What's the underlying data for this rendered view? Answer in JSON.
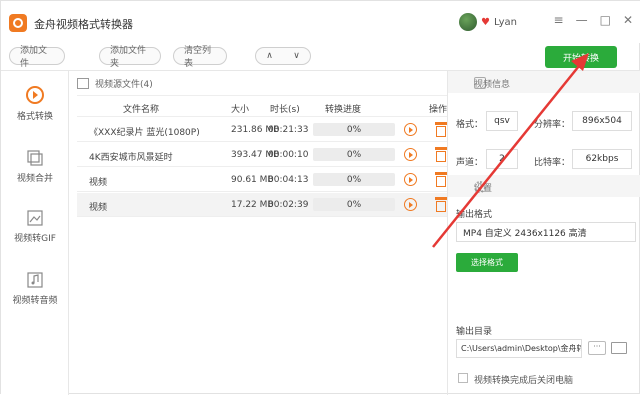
{
  "window": {
    "title": "金舟视频格式转换器",
    "user_name": "Lyan",
    "controls": [
      "≡",
      "—",
      "□",
      "✕"
    ]
  },
  "toolbar": {
    "add_file": "添加文件",
    "add_folder": "添加文件夹",
    "clear_list": "清空列表",
    "up": "∧",
    "down": "∨",
    "start": "开始转换"
  },
  "sidebar": {
    "items": [
      {
        "label": "格式转换",
        "icon": "convert-icon",
        "active": true
      },
      {
        "label": "视频合并",
        "icon": "merge-icon",
        "active": false
      },
      {
        "label": "视频转GIF",
        "icon": "gif-icon",
        "active": false
      },
      {
        "label": "视频转音频",
        "icon": "audio-icon",
        "active": false
      }
    ]
  },
  "file_list": {
    "header": "视频源文件(4)",
    "columns": [
      "文件名称",
      "大小",
      "时长(s)",
      "转换进度",
      "操作"
    ],
    "rows": [
      {
        "name": "《XXX纪录片 蓝光(1080P)",
        "size": "231.86 MB",
        "duration": "00:21:33",
        "progress": "0%"
      },
      {
        "name": "4K西安城市风景延时",
        "size": "393.47 MB",
        "duration": "00:00:10",
        "progress": "0%"
      },
      {
        "name": "视频",
        "size": "90.61 MB",
        "duration": "00:04:13",
        "progress": "0%"
      },
      {
        "name": "视频",
        "size": "17.22 MB",
        "duration": "00:02:39",
        "progress": "0%"
      }
    ]
  },
  "video_info": {
    "header": "视频信息",
    "format_label": "格式：",
    "format_value": "qsv",
    "resolution_label": "分辨率：",
    "resolution_value": "896x504",
    "channel_label": "声道：",
    "channel_value": "2",
    "bitrate_label": "比特率：",
    "bitrate_value": "62kbps"
  },
  "settings": {
    "header": "设置",
    "output_format_label": "输出格式",
    "output_format_value": "MP4 自定义 2436x1126 高清",
    "choose_format": "选择格式",
    "output_dir_label": "输出目录",
    "output_dir_value": "C:\\Users\\admin\\Desktop\\金舟转",
    "browse": "···",
    "shutdown_label": "视频转换完成后关闭电脑"
  },
  "colors": {
    "accent": "#f07a22",
    "green": "#2bab3b",
    "annotation": "#e53935"
  }
}
